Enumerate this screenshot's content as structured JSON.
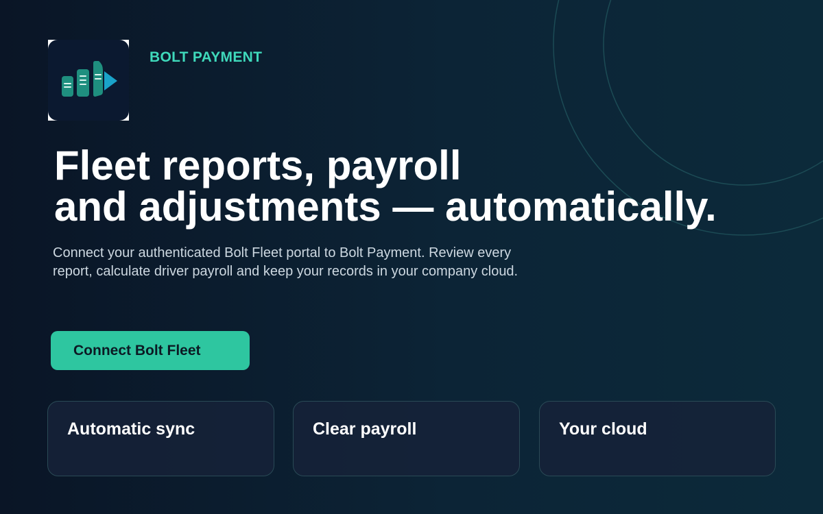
{
  "brand": {
    "name": "BOLT PAYMENT",
    "logo_icon": "bolt-payment-logo-icon"
  },
  "hero": {
    "headline_line1": "Fleet reports, payroll",
    "headline_line2": "and adjustments — automatically.",
    "subtitle": "Connect your authenticated Bolt Fleet portal to Bolt Payment. Review every report, calculate driver payroll and keep your records in your company cloud."
  },
  "cta": {
    "label": "Connect Bolt Fleet"
  },
  "features": [
    {
      "title": "Automatic sync"
    },
    {
      "title": "Clear payroll"
    },
    {
      "title": "Your cloud"
    }
  ],
  "colors": {
    "accent": "#2ec6a0",
    "brand_text": "#3fd9bb",
    "background_start": "#0a1526",
    "background_end": "#0c2a3a",
    "logo_background": "#0b1930",
    "logo_bars": "#1f8f7f",
    "logo_arrow": "#1aa3c9"
  }
}
